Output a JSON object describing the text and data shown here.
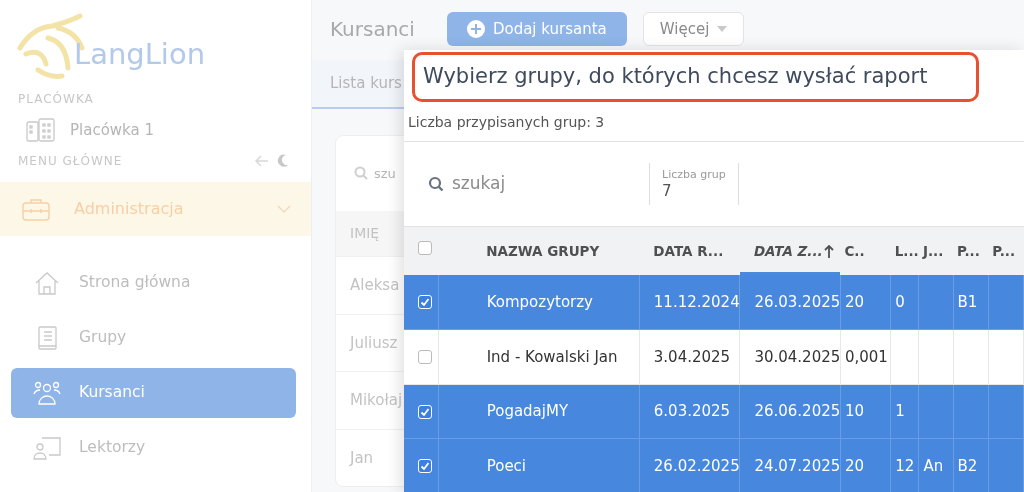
{
  "sidebar": {
    "logo": "LangLion",
    "branch_label": "PLACÓWKA",
    "branch": "Placówka 1",
    "menu_label": "MENU GŁÓWNE",
    "menu_group": {
      "label": "Administracja",
      "expanded": true
    },
    "items": [
      {
        "label": "Strona główna",
        "selected": false
      },
      {
        "label": "Grupy",
        "selected": false
      },
      {
        "label": "Kursanci",
        "selected": true
      },
      {
        "label": "Lektorzy",
        "selected": false
      }
    ]
  },
  "page": {
    "title": "Kursanci",
    "add_button": "Dodaj kursanta",
    "more_button": "Więcej",
    "tab": "Lista kurs",
    "search_placeholder": "szu",
    "column": "IMIĘ",
    "rows": [
      "Aleksa",
      "Juliusz",
      "Mikołaj",
      "Jan"
    ]
  },
  "modal": {
    "title": "Wybierz grupy, do których chcesz wysłać raport",
    "assigned": "Liczba przypisanych grup: 3",
    "search_placeholder": "szukaj",
    "count_label": "Liczba grup",
    "count": "7",
    "select_all": {
      "checked": false
    },
    "columns": [
      {
        "label": "NAZWA GRUPY",
        "sorted": false
      },
      {
        "label": "DATA R...",
        "sorted": false
      },
      {
        "label": "DATA Z...",
        "sorted": true
      },
      {
        "label": "C..",
        "sorted": false
      },
      {
        "label": "L...",
        "sorted": false
      },
      {
        "label": "J...",
        "sorted": false
      },
      {
        "label": "P...",
        "sorted": false
      },
      {
        "label": "P...",
        "sorted": false
      }
    ],
    "rows": [
      {
        "selected": true,
        "cells": [
          "Kompozytorzy",
          "11.12.2024",
          "26.03.2025",
          "20",
          "0",
          "",
          "B1",
          ""
        ]
      },
      {
        "selected": false,
        "cells": [
          "Ind - Kowalski Jan",
          "3.04.2025",
          "30.04.2025",
          "0,001",
          "",
          "",
          "",
          ""
        ]
      },
      {
        "selected": true,
        "cells": [
          "PogadajMY",
          "6.03.2025",
          "26.06.2025",
          "10",
          "1",
          "",
          "",
          ""
        ]
      },
      {
        "selected": true,
        "cells": [
          "Poeci",
          "26.02.2025",
          "24.07.2025",
          "20",
          "12",
          "An",
          "B2",
          ""
        ]
      }
    ]
  }
}
